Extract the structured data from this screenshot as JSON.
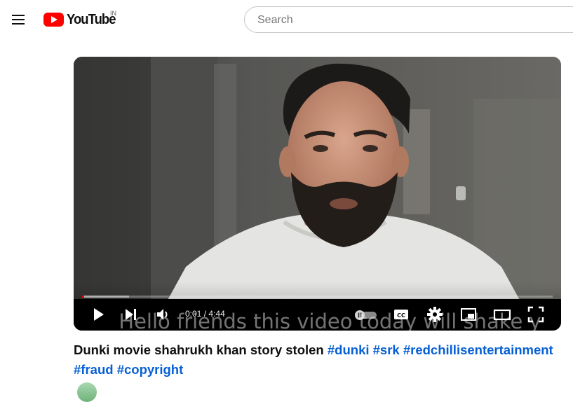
{
  "header": {
    "logo_text": "YouTube",
    "country_code": "IN",
    "search_placeholder": "Search"
  },
  "player": {
    "current_time": "0:01",
    "separator": "/",
    "duration": "4:44",
    "progress_played_fraction": 0.005,
    "progress_loaded_fraction": 0.1,
    "caption_text": "Hello friends this video today will shake y",
    "autoplay_enabled": false
  },
  "video": {
    "title_text": "Dunki movie shahrukh khan story stolen",
    "hashtags": [
      "#dunki",
      "#srk",
      "#redchillisentertainment",
      "#fraud",
      "#copyright"
    ]
  },
  "colors": {
    "brand_red": "#ff0000",
    "link_blue": "#065fd4",
    "text_primary": "#0f0f0f"
  }
}
